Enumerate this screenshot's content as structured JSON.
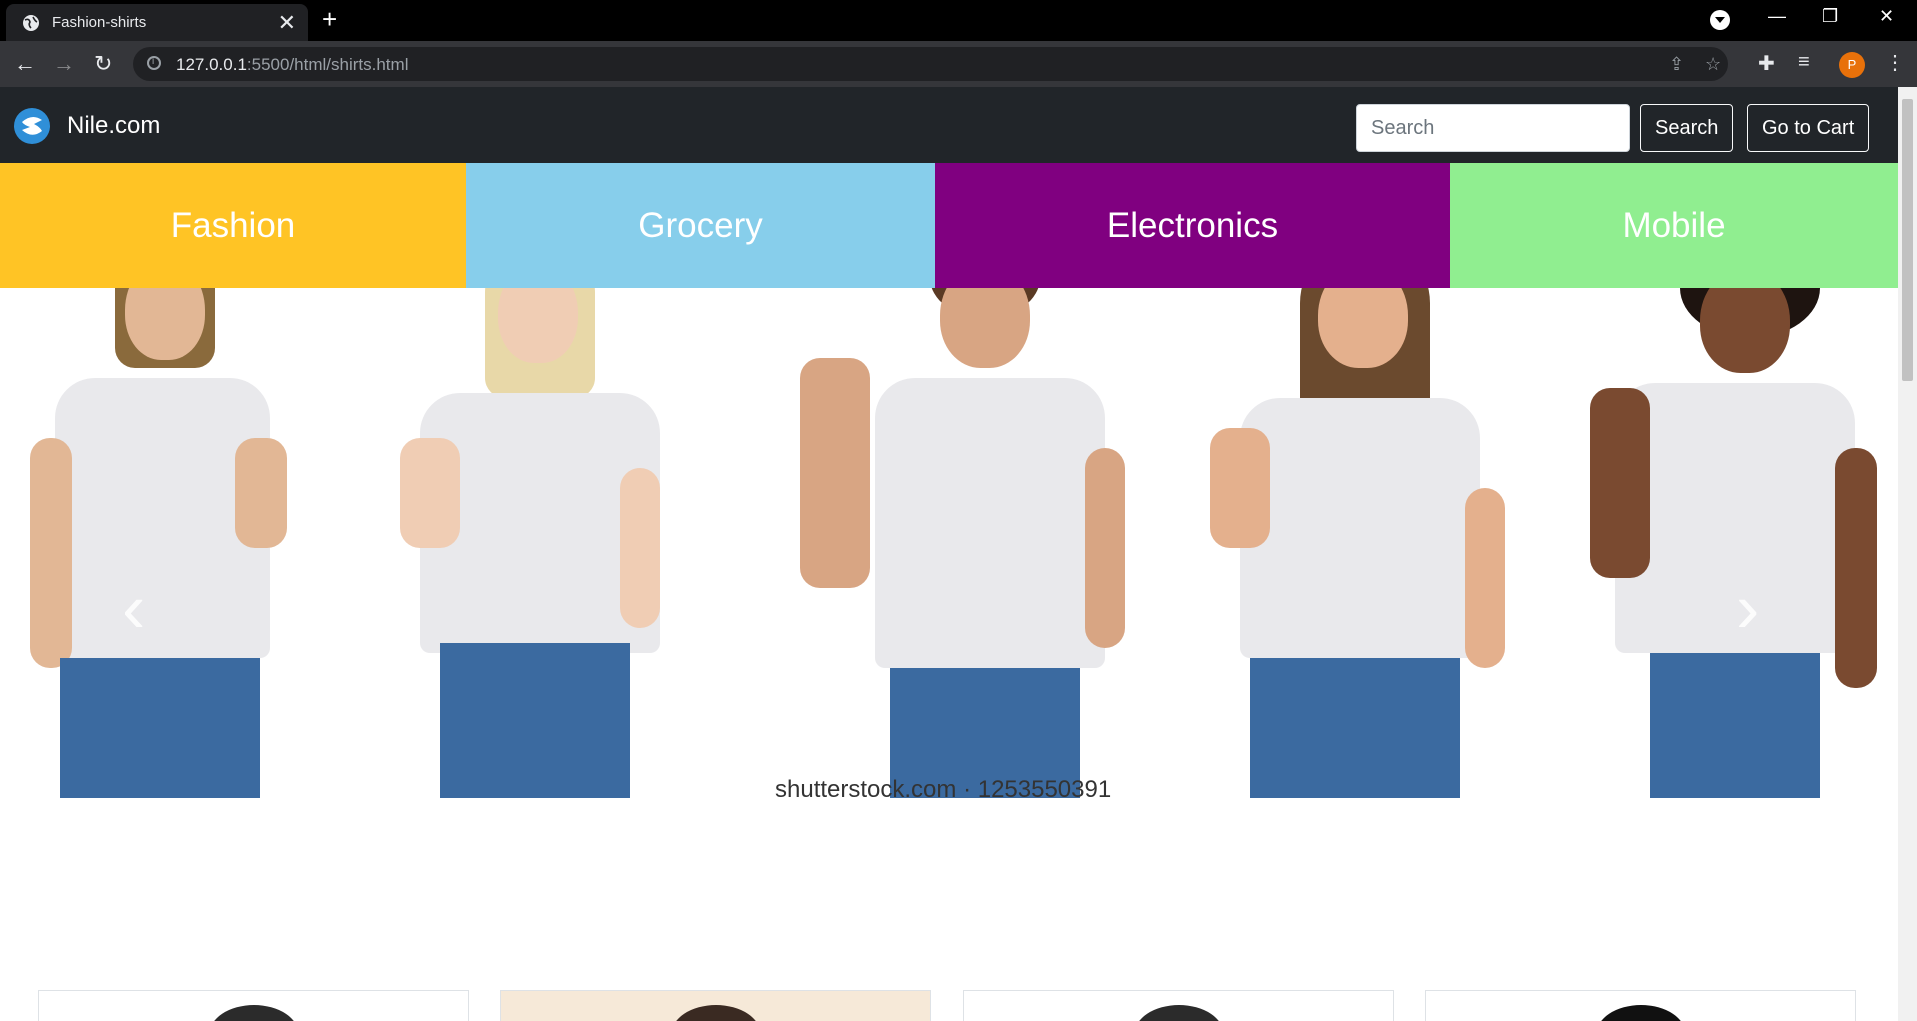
{
  "browser": {
    "tab_title": "Fashion-shirts",
    "tab_close": "✕",
    "new_tab": "+",
    "url_host": "127.0.0.1",
    "url_rest": ":5500/html/shirts.html",
    "profile_initial": "P",
    "window_controls": [
      "—",
      "❐",
      "✕"
    ]
  },
  "site": {
    "brand": "Nile.com",
    "search_placeholder": "Search",
    "search_button": "Search",
    "cart_button": "Go to Cart"
  },
  "categories": [
    {
      "label": "Fashion",
      "color": "#ffc425"
    },
    {
      "label": "Grocery",
      "color": "#87ceeb"
    },
    {
      "label": "Electronics",
      "color": "#800080"
    },
    {
      "label": "Mobile",
      "color": "#90ee90"
    }
  ],
  "carousel": {
    "watermark": "shutterstock.com · 1253550391",
    "prev": "‹",
    "next": "›"
  },
  "colors": {
    "navbar": "#212529",
    "browser_chrome": "#35363a",
    "profile": "#e8710a"
  }
}
